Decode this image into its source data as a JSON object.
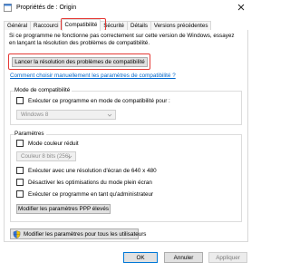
{
  "window": {
    "title": "Propriétés de : Origin",
    "colors": {
      "highlight": "#e53935",
      "link": "#0066cc",
      "accent": "#0078d7"
    }
  },
  "tabs": [
    {
      "label": "Général"
    },
    {
      "label": "Raccourci"
    },
    {
      "label": "Compatibilité"
    },
    {
      "label": "Sécurité"
    },
    {
      "label": "Détails"
    },
    {
      "label": "Versions précédentes"
    }
  ],
  "intro_text": "Si ce programme ne fonctionne pas correctement sur cette version de Windows, essayez en lançant la résolution des problèmes de compatibilité.",
  "troubleshoot_button": "Lancer la résolution des problèmes de compatibilité",
  "manual_link": "Comment choisir manuellement les paramètres de compatibilité ?",
  "compat_mode": {
    "group_label": "Mode de compatibilité",
    "checkbox_label": "Exécuter ce programme en mode de compatibilité pour :",
    "select_value": "Windows 8"
  },
  "settings": {
    "group_label": "Paramètres",
    "reduced_color_label": "Mode couleur réduit",
    "color_select_value": "Couleur 8 bits (256)",
    "resolution_label": "Exécuter avec une résolution d'écran de 640 x 480",
    "fullscreen_opt_label": "Désactiver les optimisations du mode plein écran",
    "admin_label": "Exécuter ce programme en tant qu'administrateur",
    "dpi_button": "Modifier les paramètres PPP élevés"
  },
  "all_users_button": "Modifier les paramètres pour tous les utilisateurs",
  "footer": {
    "ok": "OK",
    "cancel": "Annuler",
    "apply": "Appliquer"
  }
}
